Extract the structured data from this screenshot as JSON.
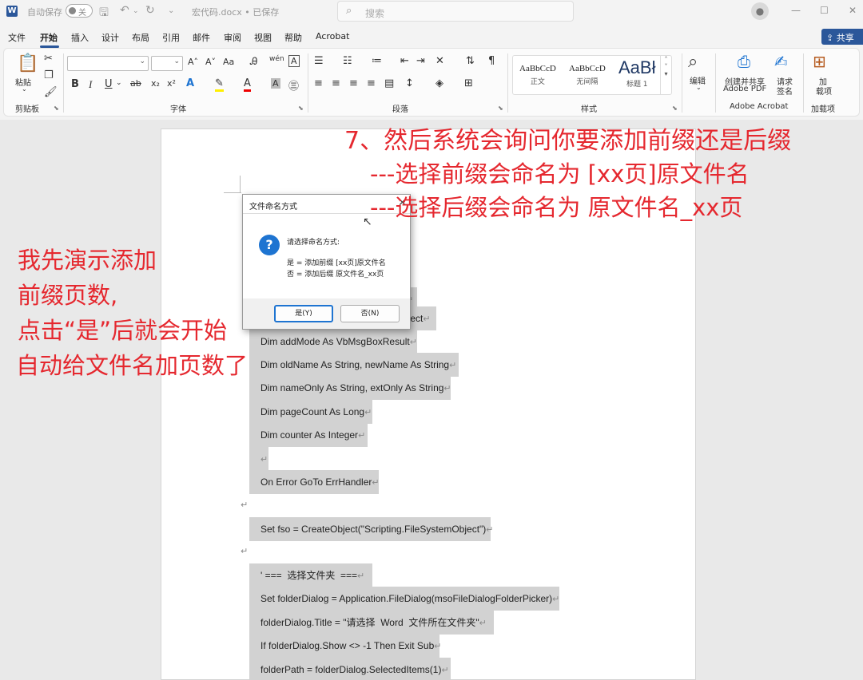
{
  "titlebar": {
    "autosave_label": "自动保存",
    "autosave_state": "关",
    "doc_name": "宏代码.docx • 已保存",
    "search_placeholder": "搜索"
  },
  "tabs": [
    "文件",
    "开始",
    "插入",
    "设计",
    "布局",
    "引用",
    "邮件",
    "审阅",
    "视图",
    "帮助",
    "Acrobat"
  ],
  "active_tab": "开始",
  "share_label": "共享",
  "ribbon": {
    "paste_label": "粘贴",
    "clipboard_group": "剪贴板",
    "font_group": "字体",
    "paragraph_group": "段落",
    "styles_group": "样式",
    "editing_label": "编辑",
    "create_pdf_label": "创建并共享",
    "create_pdf_label2": "Adobe PDF",
    "request_sign_label": "请求",
    "request_sign_label2": "签名",
    "adobe_group": "Adobe Acrobat",
    "addins_label": "加",
    "addins_label2": "载项",
    "addins_group": "加载项",
    "font_grow": "A˄",
    "font_shrink": "A˅",
    "change_case": "Aa",
    "styles": [
      {
        "sample": "AaBbCcD",
        "name": "正文"
      },
      {
        "sample": "AaBbCcD",
        "name": "无间隔"
      },
      {
        "sample": "AaBł",
        "name": "标题 1"
      }
    ]
  },
  "dialog": {
    "title": "文件命名方式",
    "prompt": "请选择命名方式:",
    "option_yes": "是 = 添加前缀 [xx页]原文件名",
    "option_no": "否 = 添加后缀 原文件名_xx页",
    "yes_button": "是(Y)",
    "no_button": "否(N)"
  },
  "code_lines": [
    "Dim addMode As VbMsgBoxResult",
    "Dim oldName As String, newName As String",
    "Dim nameOnly As String, extOnly As String",
    "Dim pageCount As Long",
    "Dim counter As Integer",
    "",
    "On Error GoTo ErrHandler",
    "",
    "Set fso = CreateObject(\"Scripting.FileSystemObject\")",
    "",
    "' ===  选择文件夹  ===",
    "Set folderDialog = Application.FileDialog(msoFileDialogFolderPicker)",
    "folderDialog.Title = \"请选择  Word  文件所在文件夹\"",
    "If folderDialog.Show <> -1 Then Exit Sub",
    "folderPath = folderDialog.SelectedItems(1)"
  ],
  "partial_line_text": "bject",
  "annotations": {
    "top_line1": "7、然后系统会询问你要添加前缀还是后缀",
    "top_line2": "---选择前缀会命名为  [xx页]原文件名",
    "top_line3": "---选择后缀会命名为  原文件名_xx页",
    "left_line1": "我先演示添加",
    "left_line2": "前缀页数,",
    "left_line3": "点击“是”后就会开始",
    "left_line4": "自动给文件名加页数了"
  },
  "colors": {
    "accent": "#2b579a",
    "annotation": "#e5282f",
    "selection": "#d2d2d2",
    "dialog_icon": "#1e74d1"
  }
}
